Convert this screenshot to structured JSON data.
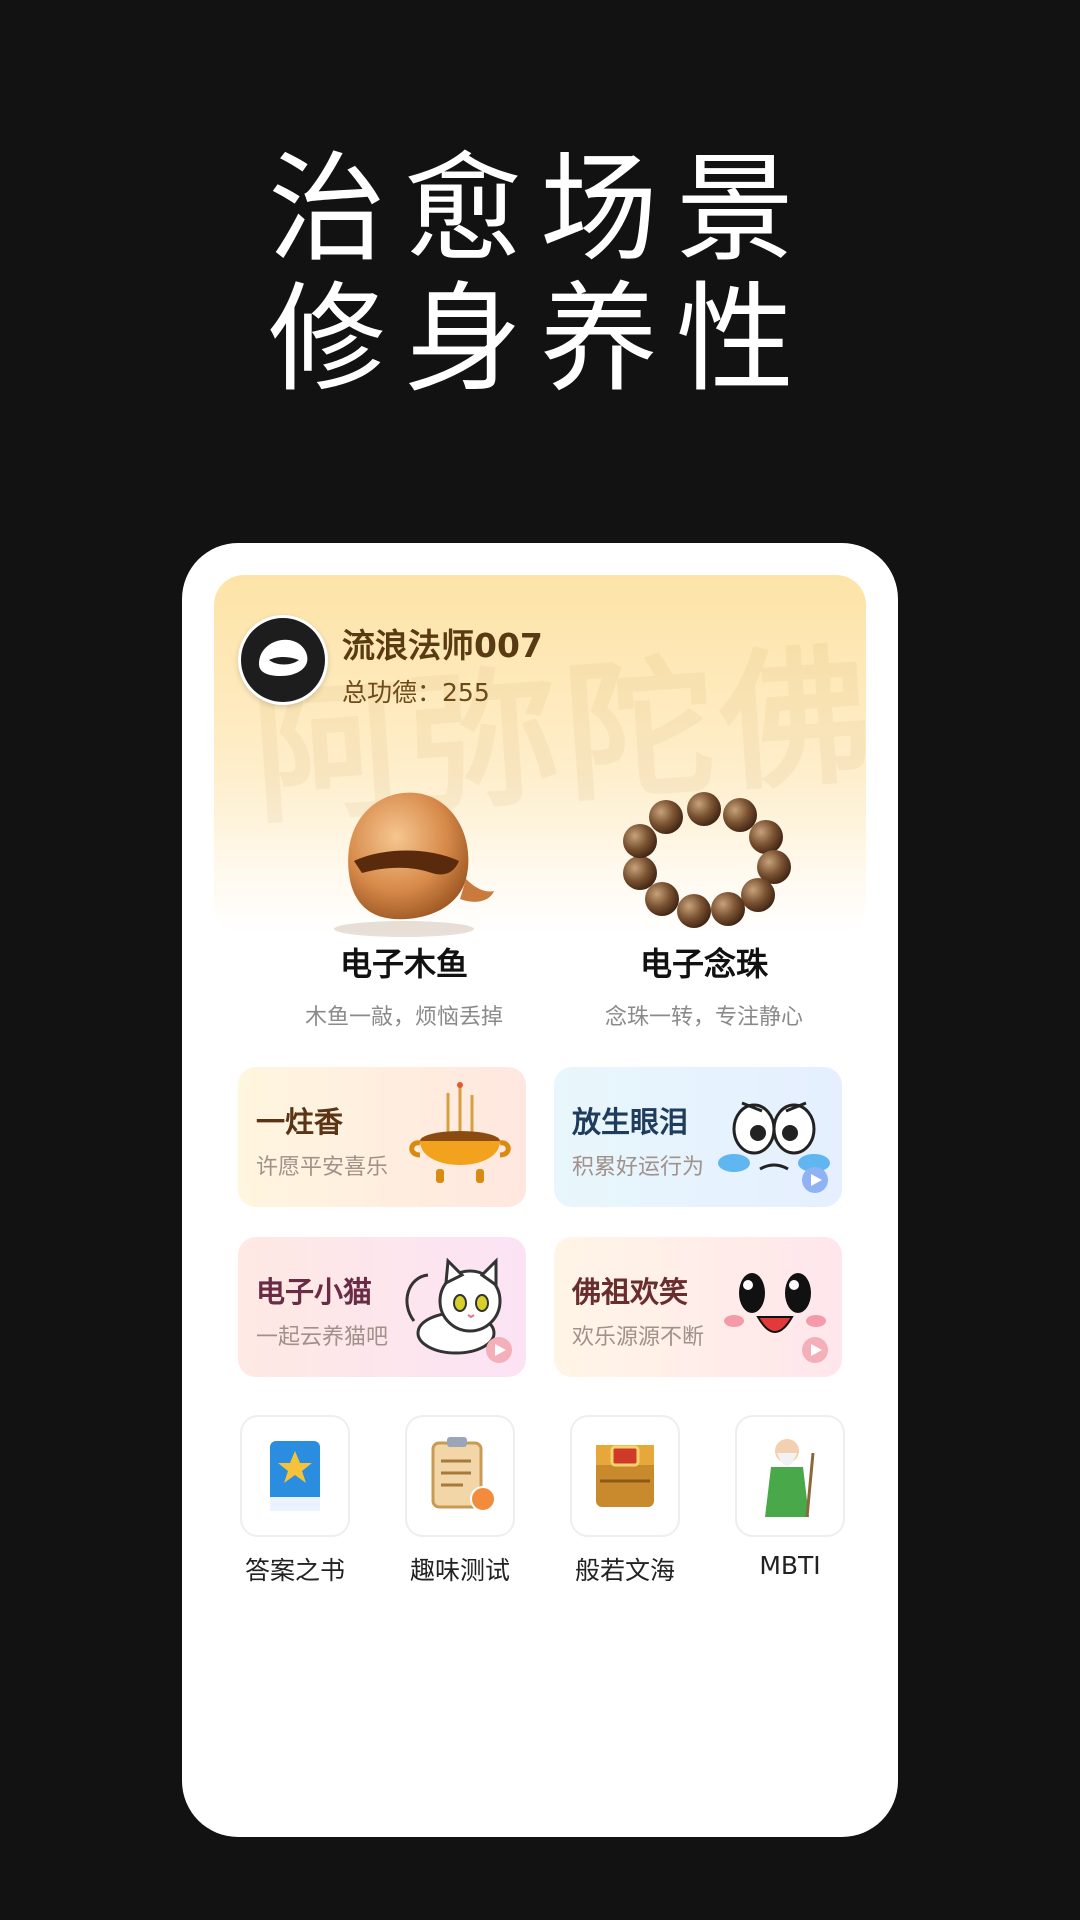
{
  "headline": {
    "line1": "治愈场景",
    "line2": "修身养性"
  },
  "profile": {
    "username": "流浪法师007",
    "merit_label": "总功德：",
    "merit_value": "255"
  },
  "tools": [
    {
      "name": "电子木鱼",
      "subtitle": "木鱼一敲，烦恼丢掉"
    },
    {
      "name": "电子念珠",
      "subtitle": "念珠一转，专注静心"
    }
  ],
  "cards": [
    {
      "title": "一炷香",
      "subtitle": "许愿平安喜乐",
      "title_color": "#5a3414"
    },
    {
      "title": "放生眼泪",
      "subtitle": "积累好运行为",
      "title_color": "#1f3c5c"
    },
    {
      "title": "电子小猫",
      "subtitle": "一起云养猫吧",
      "title_color": "#6a2b45"
    },
    {
      "title": "佛祖欢笑",
      "subtitle": "欢乐源源不断",
      "title_color": "#6a2d2d"
    }
  ],
  "shortcuts": [
    {
      "label": "答案之书"
    },
    {
      "label": "趣味测试"
    },
    {
      "label": "般若文海"
    },
    {
      "label": "MBTI"
    }
  ]
}
